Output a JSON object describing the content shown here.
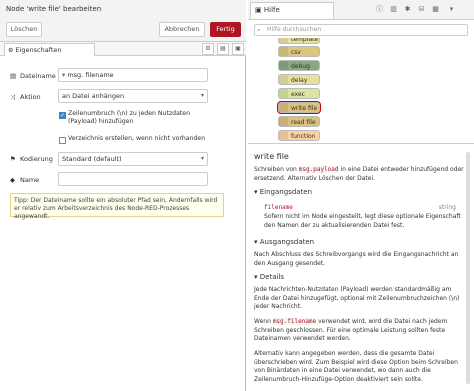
{
  "editor": {
    "title": "Node 'write file' bearbeiten",
    "delete_label": "Löschen",
    "cancel_label": "Abbrechen",
    "done_label": "Fertig",
    "tab_properties": "Eigenschaften",
    "filename_label": "Dateiname",
    "filename_value": "msg. filename",
    "action_label": "Aktion",
    "action_value": "an Datei anhängen",
    "newline_label": "Zeilenumbruch (\\n) zu jeden Nutzdaten (Payload) hinzufügen",
    "createdir_label": "Verzeichnis erstellen, wenn nicht vorhanden",
    "encoding_label": "Kodierung",
    "encoding_value": "Standard (default)",
    "name_label": "Name",
    "name_value": "",
    "tip": "Tipp: Der Dateiname sollte ein absoluter Pfad sein, Andernfalls wird er relativ zum Arbeitsverzeichnis des Node-RED-Prozesses angewandt."
  },
  "sidebar": {
    "tab_label": "Hilfe",
    "search_placeholder": "Hilfe durchsuchen",
    "palette": [
      {
        "label": "template",
        "color": "#e6e0a1"
      },
      {
        "label": "csv",
        "color": "#dcc77c"
      },
      {
        "label": "debug",
        "color": "#87a980"
      },
      {
        "label": "delay",
        "color": "#e6e0a1"
      },
      {
        "label": "exec",
        "color": "#dbe4a2"
      },
      {
        "label": "write file",
        "color": "#dcc17d"
      },
      {
        "label": "read file",
        "color": "#dcc17d"
      },
      {
        "label": "function",
        "color": "#fdd0a2"
      }
    ]
  },
  "help": {
    "title": "write file",
    "intro_a": "Schreiben von",
    "intro_code": "msg.payload",
    "intro_b": "in eine Datei entweder hinzufügend oder ersetzend. Alternativ Löschen der Datei.",
    "inputs_heading": "Eingangsdaten",
    "prop_name": "filename",
    "prop_type": "string",
    "prop_desc": "Sofern nicht im Node eingestellt, legt diese optionale Eigenschaft den Namen der zu aktualisierenden Datei fest.",
    "outputs_heading": "Ausgangsdaten",
    "outputs_text": "Nach Abschluss des Schreibvorgangs wird die Eingangsnachricht an den Ausgang gesendet.",
    "details_heading": "Details",
    "details_1": "Jede Nachrichten-Nutzdaten (Payload) werden standardmäßig am Ende der Datei hinzugefügt, optional mit Zeilenumbruchzeichen (\\n) jeder Nachricht.",
    "details_2a": "Wenn",
    "details_2code": "msg.filename",
    "details_2b": "verwendet wird, wird die Datei nach jedem Schreiben geschlossen. Für eine optimale Leistung sollten feste Dateinamen verwendet werden.",
    "details_3": "Alternativ kann angegeben werden, dass die gesamte Datei überschrieben wird. Zum Beispiel wird diese Option beim Schreiben von Binärdaten in eine Datei verwendet, wo dann auch die Zeilenumbruch-Hinzufüge-Option deaktiviert sein sollte."
  }
}
